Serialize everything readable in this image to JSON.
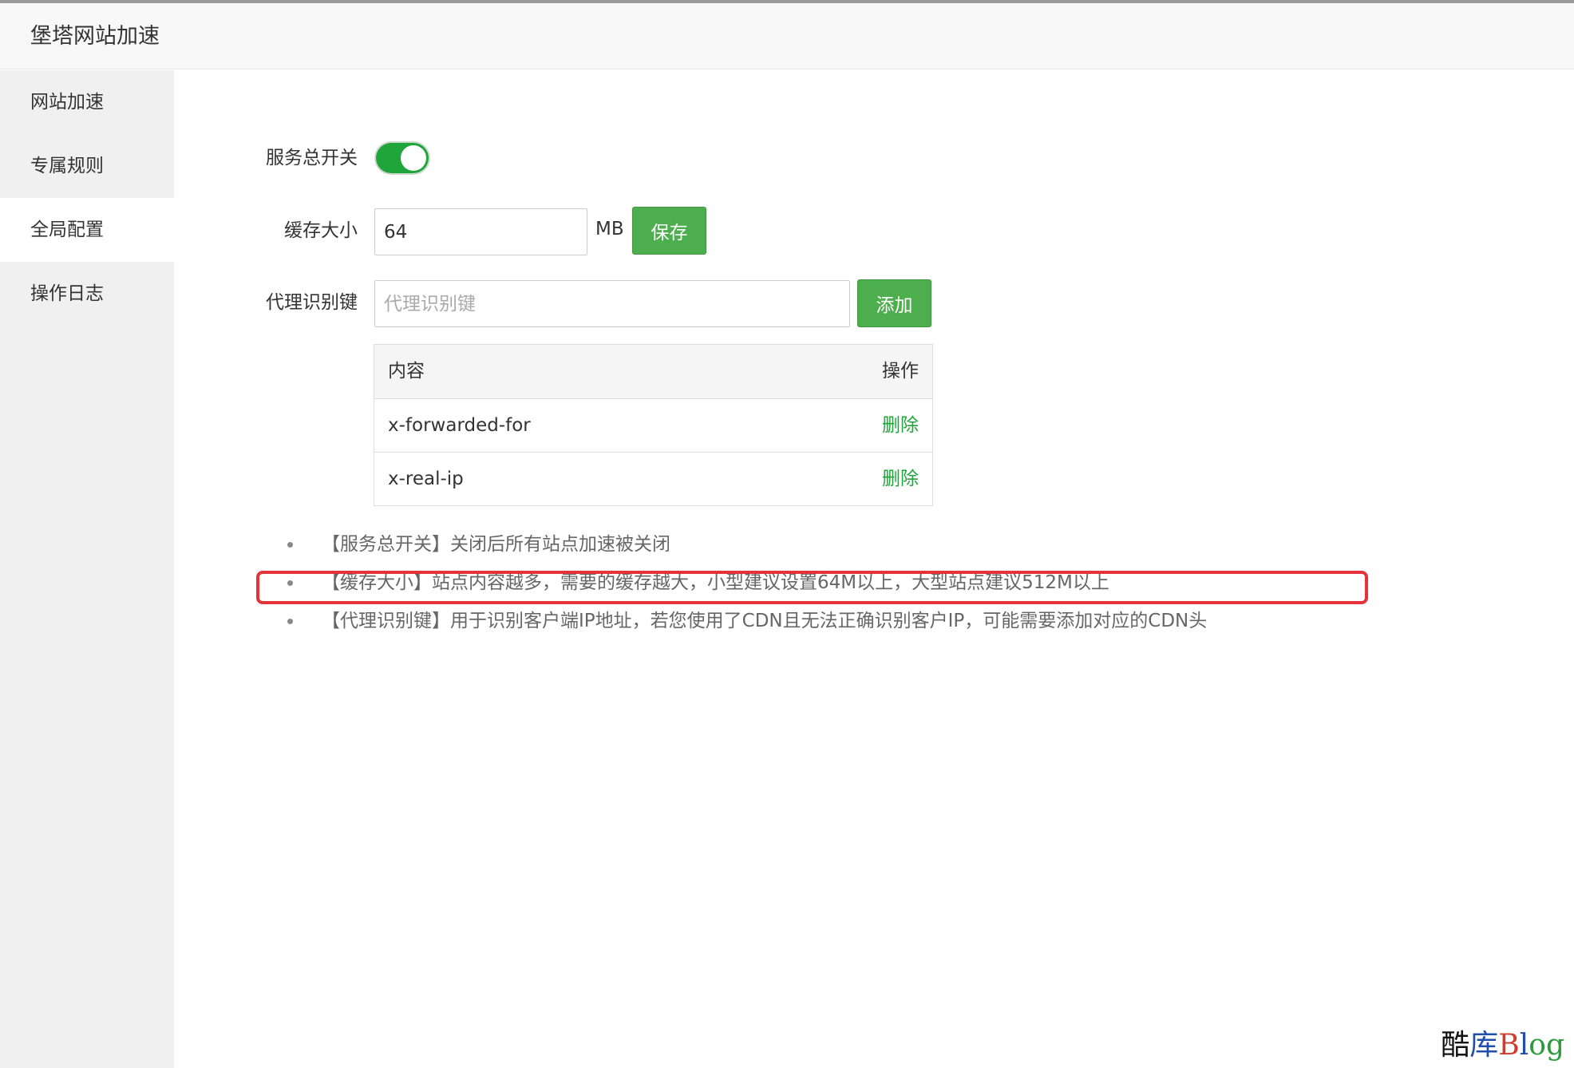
{
  "window": {
    "title": "堡塔网站加速"
  },
  "sidebar": {
    "items": [
      {
        "label": "网站加速",
        "active": false
      },
      {
        "label": "专属规则",
        "active": false
      },
      {
        "label": "全局配置",
        "active": true
      },
      {
        "label": "操作日志",
        "active": false
      }
    ]
  },
  "form": {
    "service_switch": {
      "label": "服务总开关",
      "enabled": true
    },
    "cache_size": {
      "label": "缓存大小",
      "value": "64",
      "unit": "MB",
      "save_label": "保存"
    },
    "proxy_key": {
      "label": "代理识别键",
      "placeholder": "代理识别键",
      "value": "",
      "add_label": "添加"
    }
  },
  "key_table": {
    "columns": [
      "内容",
      "操作"
    ],
    "rows": [
      {
        "content": "x-forwarded-for",
        "action": "删除"
      },
      {
        "content": "x-real-ip",
        "action": "删除"
      }
    ]
  },
  "notes": [
    "【服务总开关】关闭后所有站点加速被关闭",
    "【缓存大小】站点内容越多，需要的缓存越大，小型建议设置64M以上，大型站点建议512M以上",
    "【代理识别键】用于识别客户端IP地址，若您使用了CDN且无法正确识别客户IP，可能需要添加对应的CDN头"
  ],
  "colors": {
    "accent_green": "#20a53a",
    "button_green": "#4cae4c",
    "highlight_red": "#e5323b"
  },
  "watermark": {
    "part1": "酷",
    "part2": "库",
    "part3": "B",
    "part4": "l",
    "part5": "og"
  }
}
